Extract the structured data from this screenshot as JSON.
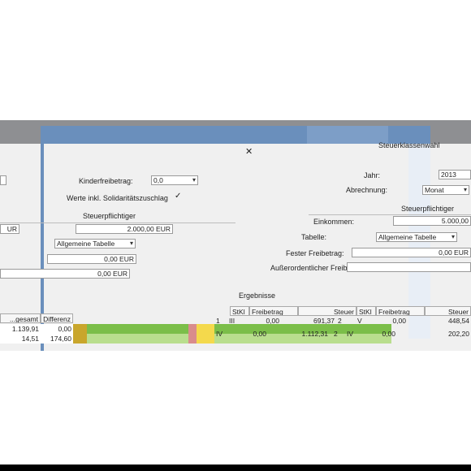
{
  "left_dialog": {
    "close_glyph": "✕",
    "kinderfreibetrag_label": "Kinderfreibetrag:",
    "kinderfreibetrag_value": "0,0",
    "soli_label": "Werte inkl. Solidaritätszuschlag",
    "soli_checked": "✓",
    "steuerpflichtiger_label": "Steuerpflichtiger",
    "amount_1": "2.000,00 EUR",
    "left_clip_1": "UR",
    "tabelle_value": "Allgemeine Tabelle",
    "amount_2": "0,00 EUR",
    "amount_3": "0,00 EUR",
    "table": {
      "headers": [
        "...gesamt",
        "Differenz"
      ],
      "rows": [
        [
          "1.139,91",
          "0,00"
        ],
        [
          "14,51",
          "174,60"
        ]
      ]
    }
  },
  "right_dialog": {
    "title": "Steuerklassenwahl",
    "jahr_label": "Jahr:",
    "jahr_value": "2013",
    "abrechnung_label": "Abrechnung:",
    "abrechnung_value": "Monat",
    "steuerpflichtiger_label": "Steuerpflichtiger",
    "einkommen_label": "Einkommen:",
    "einkommen_value": "5.000,00",
    "tabelle_label": "Tabelle:",
    "tabelle_value": "Allgemeine Tabelle",
    "fester_label": "Fester Freibetrag:",
    "fester_value": "0,00 EUR",
    "ausser_label": "Außerordentlicher Freibetrag:",
    "ausser_value": "",
    "ergebnisse_label": "Ergebnisse",
    "table": {
      "headers": [
        "StKl",
        "Freibetrag",
        "Steuer",
        "StKl",
        "Freibetrag",
        "Steuer"
      ],
      "rows": [
        [
          "1",
          "III",
          "0,00",
          "691,37",
          "2",
          "V",
          "0,00",
          "448,54"
        ],
        [
          "",
          "IV",
          "0,00",
          "1.112,31",
          "2",
          "IV",
          "0,00",
          "202,20"
        ]
      ]
    }
  }
}
